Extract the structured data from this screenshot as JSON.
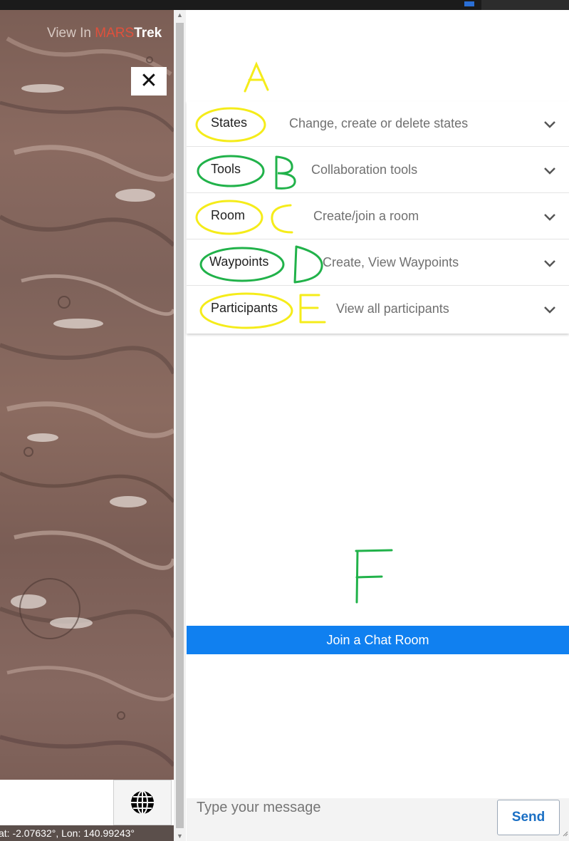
{
  "map": {
    "view_in_prefix": "View In ",
    "view_in_brand_a": "MARS",
    "view_in_brand_b": "Trek",
    "close_glyph": "✕",
    "coordinates": "at: -2.07632°, Lon: 140.99243°",
    "globe_icon": "globe-icon"
  },
  "accordion": [
    {
      "label": "States",
      "description": "Change, create or delete states"
    },
    {
      "label": "Tools",
      "description": "Collaboration tools"
    },
    {
      "label": "Room",
      "description": "Create/join a room"
    },
    {
      "label": "Waypoints",
      "description": "Create, View Waypoints"
    },
    {
      "label": "Participants",
      "description": "View all participants"
    }
  ],
  "annotations": {
    "a": "A",
    "b": "B",
    "c": "C",
    "d": "D",
    "e": "E",
    "f": "F"
  },
  "chat": {
    "join_label": "Join a Chat Room",
    "message_placeholder": "Type your message",
    "send_label": "Send"
  },
  "colors": {
    "accent": "#1080f0",
    "annotation_yellow": "#f5ec1a",
    "annotation_green": "#21b24a",
    "brand_red": "#e0503c"
  }
}
